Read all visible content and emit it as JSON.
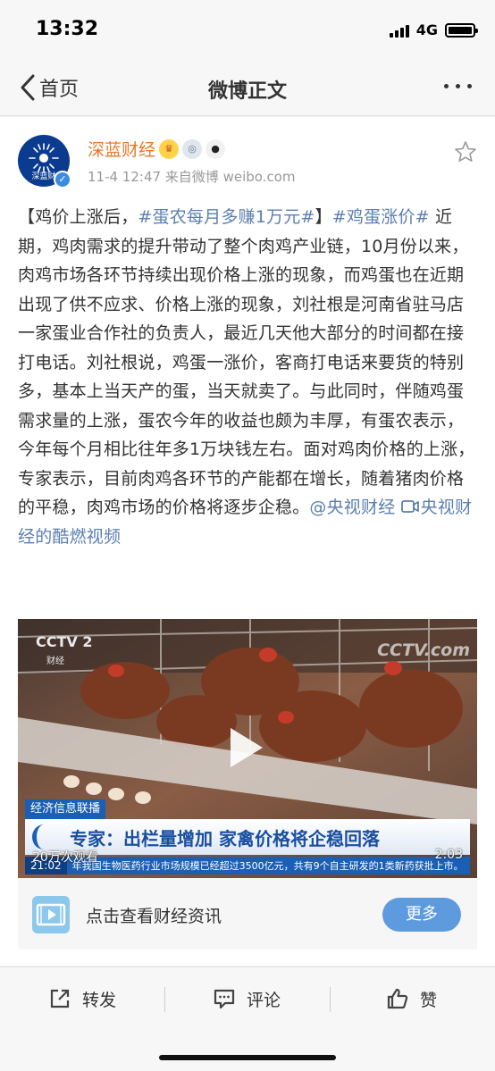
{
  "status_bar": {
    "time": "13:32",
    "network": "4G"
  },
  "nav": {
    "back_label": "首页",
    "title": "微博正文"
  },
  "post": {
    "author": {
      "name": "深蓝财经",
      "avatar_text": "深蓝财",
      "badges": [
        "crown-badge",
        "medal-badge",
        "panda-badge"
      ]
    },
    "meta": "11-4 12:47  来自微博 weibo.com",
    "text_parts": [
      {
        "type": "text",
        "value": "【鸡价上涨后，"
      },
      {
        "type": "topic",
        "value": "#蛋农每月多赚1万元#"
      },
      {
        "type": "text",
        "value": "】"
      },
      {
        "type": "topic",
        "value": "#鸡蛋涨价#"
      },
      {
        "type": "text",
        "value": " 近期，鸡肉需求的提升带动了整个肉鸡产业链，10月份以来，肉鸡市场各环节持续出现价格上涨的现象，而鸡蛋也在近期出现了供不应求、价格上涨的现象，刘社根是河南省驻马店一家蛋业合作社的负责人，最近几天他大部分的时间都在接打电话。刘社根说，鸡蛋一涨价，客商打电话来要货的特别多，基本上当天产的蛋，当天就卖了。与此同时，伴随鸡蛋需求量的上涨，蛋农今年的收益也颇为丰厚，有蛋农表示，今年每个月相比往年多1万块钱左右。面对鸡肉价格的上涨，专家表示，目前肉鸡各环节的产能都在增长，随着猪肉价格的平稳，肉鸡市场的价格将逐步企稳。"
      },
      {
        "type": "mention",
        "value": "@央视财经"
      },
      {
        "type": "text",
        "value": " "
      },
      {
        "type": "link",
        "value": "央视财经的酷燃视频"
      }
    ]
  },
  "video": {
    "logo_left": "CCTV 2",
    "logo_sub": "财经",
    "logo_right": "CCTV.com",
    "news_tag": "经济信息联播",
    "headline": "专家：出栏量增加 家禽价格将企稳回落",
    "ticker_time": "21:02",
    "ticker_text": "年我国生物医药行业市场规模已经超过3500亿元，共有9个自主研发的1类新药获批上市。",
    "view_count": "20万次观看",
    "duration": "2:03"
  },
  "promo": {
    "label": "点击查看财经资讯",
    "button": "更多"
  },
  "actions": {
    "repost": "转发",
    "comment": "评论",
    "like": "赞"
  },
  "colors": {
    "author": "#e8772a",
    "link": "#5b7fb0",
    "button": "#5e9bde"
  }
}
